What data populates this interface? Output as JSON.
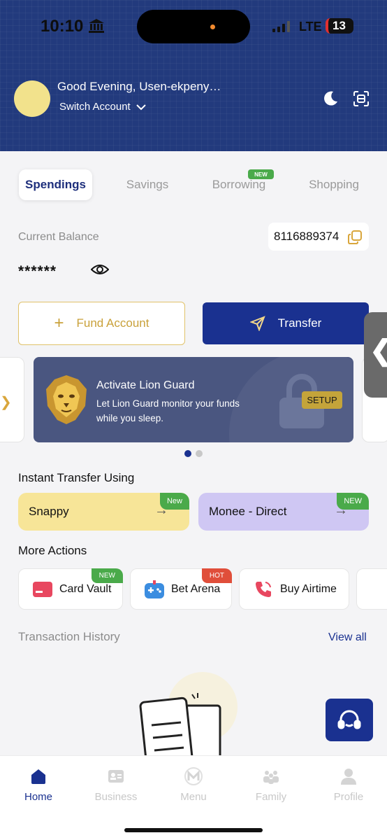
{
  "status_bar": {
    "time": "10:10",
    "network": "LTE",
    "battery": "13"
  },
  "header": {
    "greeting": "Good Evening,  Usen-ekpeny…",
    "switch_account": "Switch Account"
  },
  "tabs": [
    {
      "label": "Spendings",
      "active": true
    },
    {
      "label": "Savings",
      "active": false
    },
    {
      "label": "Borrowing",
      "active": false,
      "badge": "NEW"
    },
    {
      "label": "Shopping",
      "active": false
    }
  ],
  "balance": {
    "label": "Current Balance",
    "account_number": "8116889374",
    "hidden_value": "******"
  },
  "actions": {
    "fund": "Fund Account",
    "transfer": "Transfer"
  },
  "promo": {
    "title": "Activate Lion Guard",
    "subtitle": "Let Lion Guard monitor your funds while you sleep.",
    "button": "SETUP",
    "pages": 2,
    "active_page": 1
  },
  "instant_transfer": {
    "title": "Instant Transfer Using",
    "options": [
      {
        "label": "Snappy",
        "badge": "New",
        "color": "#f7e598"
      },
      {
        "label": "Monee - Direct",
        "badge": "NEW",
        "color": "#cfc7f3"
      }
    ]
  },
  "more_actions": {
    "title": "More Actions",
    "items": [
      {
        "label": "Card Vault",
        "badge": "NEW",
        "badge_color": "#4aaa4a",
        "icon": "card-icon"
      },
      {
        "label": "Bet Arena",
        "badge": "HOT",
        "badge_color": "#e04e3a",
        "icon": "gamepad-icon"
      },
      {
        "label": "Buy Airtime",
        "badge": "",
        "icon": "phone-icon"
      }
    ]
  },
  "transactions": {
    "title": "Transaction History",
    "view_all": "View all"
  },
  "nav": [
    {
      "label": "Home",
      "icon": "home-icon",
      "active": true
    },
    {
      "label": "Business",
      "icon": "business-icon",
      "active": false
    },
    {
      "label": "Menu",
      "icon": "menu-logo-icon",
      "active": false
    },
    {
      "label": "Family",
      "icon": "family-icon",
      "active": false
    },
    {
      "label": "Profile",
      "icon": "profile-icon",
      "active": false
    }
  ],
  "colors": {
    "header_bg": "#223a7d",
    "primary": "#1a3190",
    "accent_gold": "#c9a13a",
    "promo_bg": "#4a5680"
  }
}
